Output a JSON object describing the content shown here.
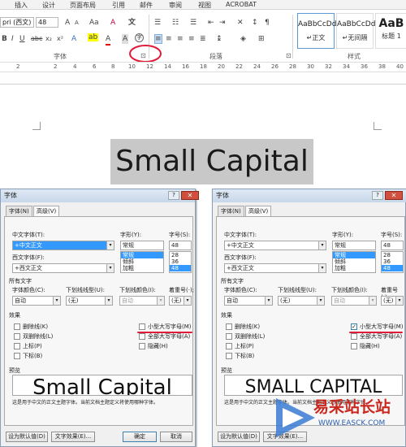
{
  "ribbon": {
    "tabs": [
      "插入",
      "设计",
      "页面布局",
      "引用",
      "邮件",
      "审阅",
      "视图",
      "ACROBAT"
    ],
    "font_name": "pri (西文)",
    "font_size": "48",
    "clear_format": "A",
    "grow": "A",
    "shrink": "A",
    "aa": "Aa",
    "bold": "B",
    "italic": "I",
    "underline": "U",
    "strike": "abc",
    "subscript": "x₂",
    "superscript": "x²",
    "font_group_label": "字体",
    "paragraph_group_label": "段落",
    "styles_group_label": "样式",
    "styles": [
      {
        "preview": "AaBbCcDd",
        "name": "↵正文"
      },
      {
        "preview": "AaBbCcDd",
        "name": "↵无间隔"
      },
      {
        "preview": "AaB",
        "name": "标题 1"
      }
    ],
    "dialog_launcher": "⊡",
    "accent_red": "#e01b3a"
  },
  "ruler": {
    "ticks": [
      "2",
      "2",
      "4",
      "6",
      "8",
      "10",
      "12",
      "14",
      "16",
      "18",
      "20",
      "22",
      "24",
      "26",
      "28",
      "30",
      "32",
      "34",
      "36",
      "38",
      "40"
    ]
  },
  "document": {
    "text": "Small Capital"
  },
  "dialog_left": {
    "title": "字体",
    "help": "?",
    "close": "✕",
    "tab_font": "字体(N)",
    "tab_advanced": "高级(V)",
    "cn_font_label": "中文字体(T):",
    "cn_font_value": "+中文正文",
    "style_label": "字形(Y):",
    "style_value": "常规",
    "size_label": "字号(S):",
    "size_value": "48",
    "style_list": [
      "常规",
      "倾斜",
      "加粗"
    ],
    "size_list": [
      "28",
      "36",
      "48"
    ],
    "west_font_label": "西文字体(F):",
    "west_font_value": "+西文正文",
    "all_text_label": "所有文字",
    "color_label": "字体颜色(C):",
    "color_value": "自动",
    "underline_label": "下划线线型(U):",
    "underline_value": "(无)",
    "underline_color_label": "下划线颜色(I):",
    "underline_color_value": "自动",
    "emphasis_label": "着重号(·);",
    "emphasis_value": "(无)",
    "effects_label": "效果",
    "eff_strike": "删除线(K)",
    "eff_dstrike": "双删除线(L)",
    "eff_super": "上标(P)",
    "eff_sub": "下标(B)",
    "eff_smallcaps": "小型大写字母(M)",
    "eff_allcaps": "全部大写字母(A)",
    "eff_hidden": "隐藏(H)",
    "smallcaps_checked": false,
    "preview_label": "预览",
    "preview_text": "Small Capital",
    "note": "这是用于中文的正文主题字体。当前文档主题定义将使用哪种字体。",
    "btn_default": "设为默认值(D)",
    "btn_effects": "文字效果(E)...",
    "btn_ok": "确定",
    "btn_cancel": "取消"
  },
  "dialog_right": {
    "title": "字体",
    "help": "?",
    "close": "✕",
    "tab_font": "字体(N)",
    "tab_advanced": "高级(V)",
    "cn_font_label": "中文字体(T):",
    "cn_font_value": "+中文正文",
    "style_label": "字形(Y):",
    "style_value": "常规",
    "size_label": "字号(S):",
    "size_value": "48",
    "style_list": [
      "常规",
      "倾斜",
      "加粗"
    ],
    "size_list": [
      "28",
      "36",
      "48"
    ],
    "west_font_label": "西文字体(F):",
    "west_font_value": "+西文正文",
    "all_text_label": "所有文字",
    "color_label": "字体颜色(C):",
    "color_value": "自动",
    "underline_label": "下划线线型(U):",
    "underline_value": "(无)",
    "underline_color_label": "下划线颜色(I):",
    "underline_color_value": "自动",
    "emphasis_label": "着重号(·);",
    "emphasis_value": "(无)",
    "effects_label": "效果",
    "eff_strike": "删除线(K)",
    "eff_dstrike": "双删除线(L)",
    "eff_super": "上标(P)",
    "eff_sub": "下标(B)",
    "eff_smallcaps": "小型大写字母(M)",
    "eff_allcaps": "全部大写字母(A)",
    "eff_hidden": "隐藏(H)",
    "smallcaps_checked": true,
    "preview_label": "预览",
    "preview_text": "SMALL CAPITAL",
    "note": "这是用于中文的正文主题字体。当前文档主题定义将使用哪种字体。",
    "btn_default": "设为默认值(D)",
    "btn_effects": "文字效果(E)..."
  },
  "watermark": {
    "text": "易采站长站",
    "url": "WWW.EASCK.COM"
  }
}
